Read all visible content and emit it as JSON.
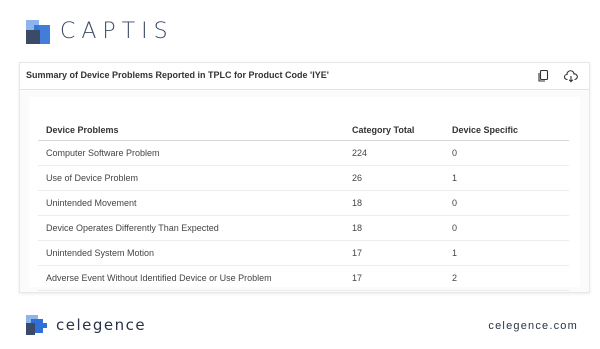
{
  "brand": {
    "name": "CAPTIS"
  },
  "card": {
    "title": "Summary of Device Problems Reported in TPLC for Product Code 'IYE'",
    "icons": [
      "copy-icon",
      "cloud-download-icon"
    ]
  },
  "table": {
    "headers": [
      "Device Problems",
      "Category Total",
      "Device Specific"
    ],
    "rows": [
      [
        "Computer Software Problem",
        "224",
        "0"
      ],
      [
        "Use of Device Problem",
        "26",
        "1"
      ],
      [
        "Unintended Movement",
        "18",
        "0"
      ],
      [
        "Device Operates Differently Than Expected",
        "18",
        "0"
      ],
      [
        "Unintended System Motion",
        "17",
        "1"
      ],
      [
        "Adverse Event Without Identified Device or Use Problem",
        "17",
        "2"
      ]
    ]
  },
  "footer": {
    "company": "celegence",
    "url": "celegence.com"
  },
  "colors": {
    "brand_dark": "#3b4a66",
    "brand_blue": "#2f6fd6",
    "brand_light": "#8fb4ec"
  }
}
